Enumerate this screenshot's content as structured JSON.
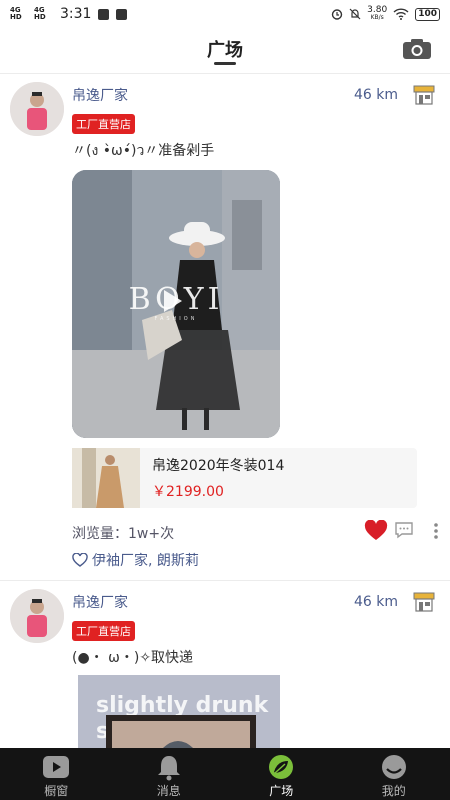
{
  "status_bar": {
    "network1": "4G HD",
    "network2": "4G HD",
    "time": "3:31",
    "speed": "3.80",
    "speed_unit": "KB/s",
    "battery": "100"
  },
  "header": {
    "title": "广场"
  },
  "posts": [
    {
      "username": "帛逸厂家",
      "badge": "工厂直营店",
      "distance": "46 km",
      "caption": "〃(ง •̀ω•́)ว〃准备剁手",
      "media_brand": "BOYI",
      "media_sub": "FASHION",
      "product_name": "帛逸2020年冬装014",
      "product_price": "￥2199.00",
      "views": "浏览量：1w+次",
      "likers": "伊袖厂家, 朗斯莉"
    },
    {
      "username": "帛逸厂家",
      "badge": "工厂直营店",
      "distance": "46 km",
      "caption": "(●・ ω・)✧取快递",
      "media_text": "slightly drunk s    k"
    }
  ],
  "tabs": [
    {
      "label": "橱窗",
      "icon": "play-icon"
    },
    {
      "label": "消息",
      "icon": "bell-icon"
    },
    {
      "label": "广场",
      "icon": "square-leaf-icon"
    },
    {
      "label": "我的",
      "icon": "profile-icon"
    }
  ],
  "colors": {
    "accent_red": "#e02222",
    "link_blue": "#4a5b8c",
    "tabbar_bg": "#141414",
    "active_tab_green": "#7bbf3a"
  }
}
